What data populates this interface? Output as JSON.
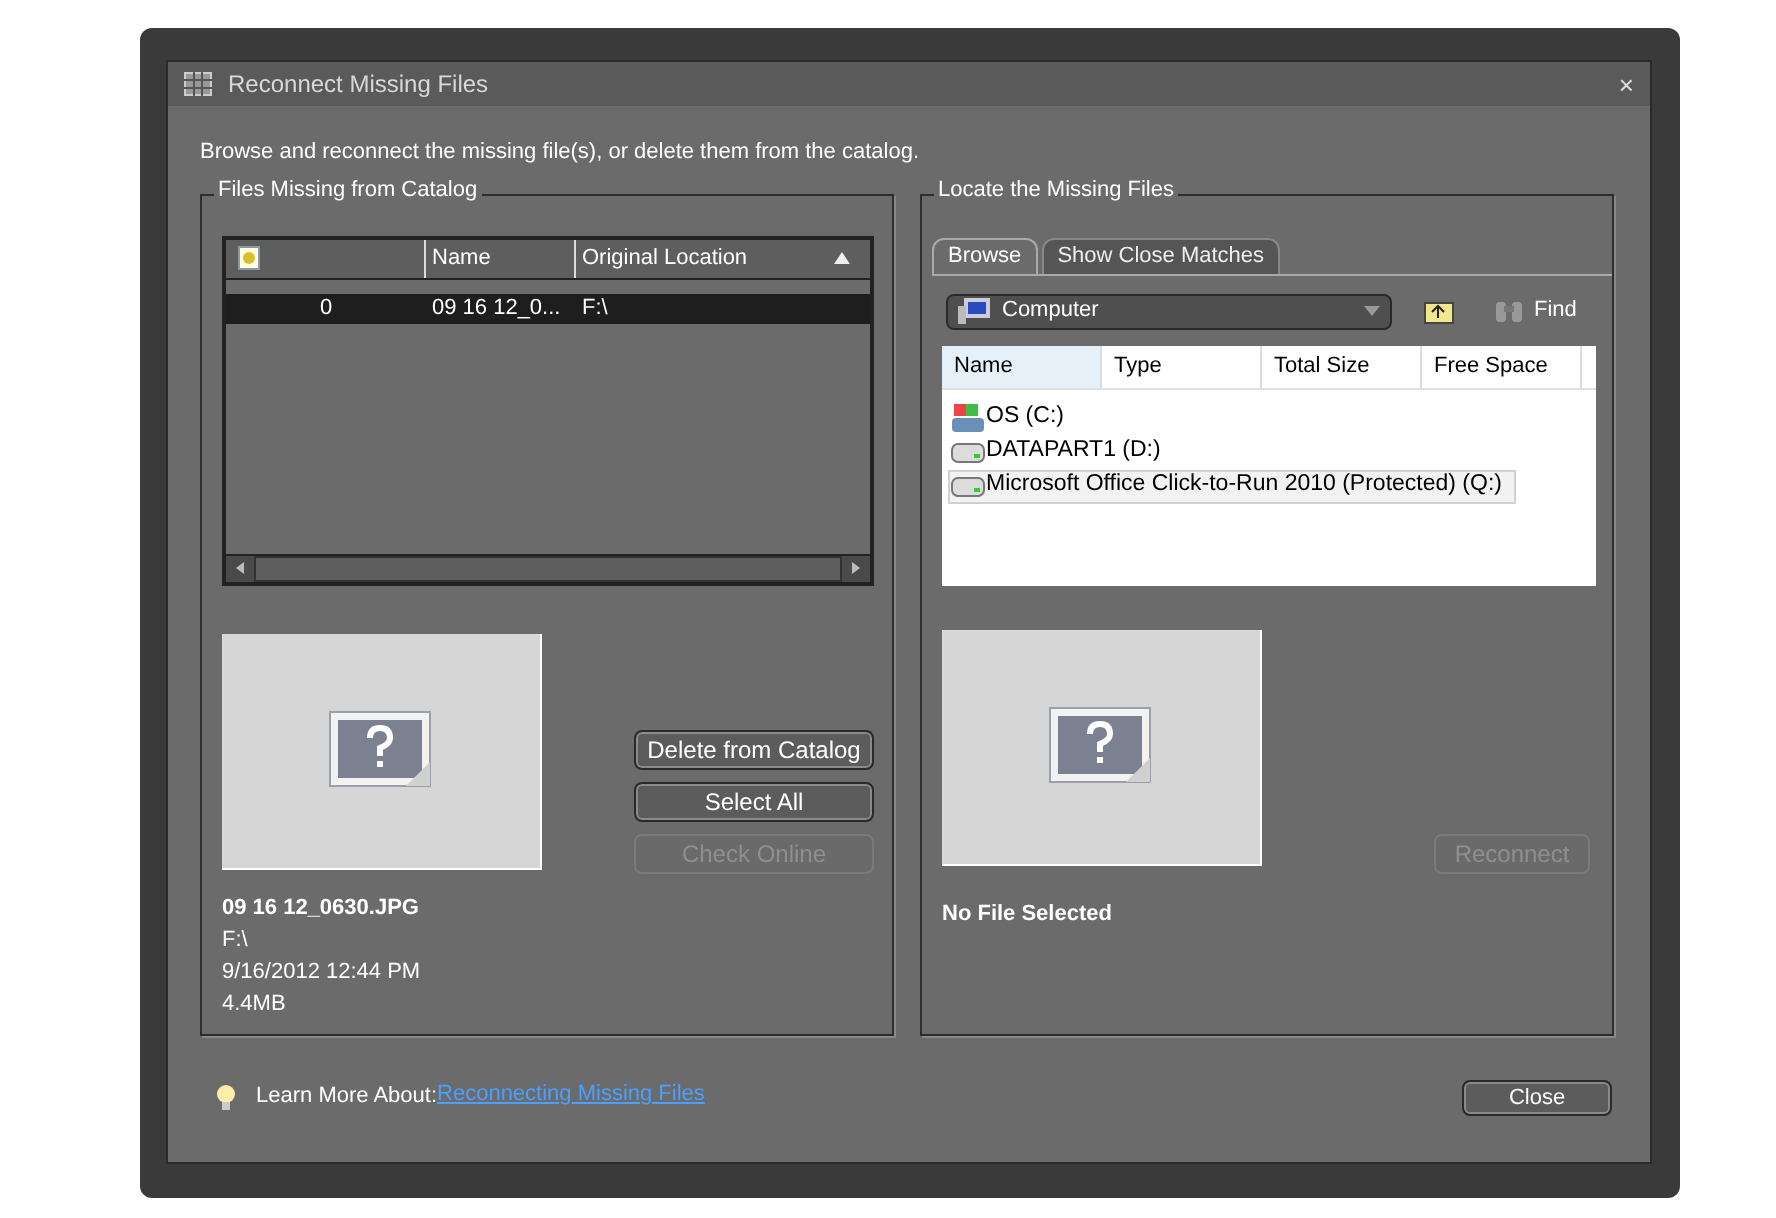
{
  "window": {
    "title": "Reconnect Missing Files",
    "close": "×"
  },
  "instructions": "Browse and reconnect the missing file(s), or delete them from the catalog.",
  "missing_panel": {
    "title": "Files Missing from Catalog",
    "table": {
      "columns": [
        "Name",
        "Original Location"
      ],
      "rows": [
        {
          "count": "0",
          "name": "09 16 12_0...",
          "location": "F:\\",
          "selected": true
        }
      ]
    },
    "file_info": {
      "name": "09 16 12_0630.JPG",
      "location": "F:\\",
      "date": "9/16/2012 12:44 PM",
      "size": "4.4MB"
    },
    "buttons": [
      {
        "label": "Delete from Catalog",
        "disabled": false
      },
      {
        "label": "Select All",
        "disabled": false
      },
      {
        "label": "Check Online",
        "disabled": true
      }
    ]
  },
  "locate_panel": {
    "title": "Locate the Missing Files",
    "tabs": [
      {
        "label": "Browse",
        "selected": true
      },
      {
        "label": "Show Close Matches",
        "selected": false
      }
    ],
    "location": "Computer",
    "find": "Find",
    "columns": [
      "Name",
      "Type",
      "Total Size",
      "Free Space"
    ],
    "drives": [
      {
        "label": "OS (C:)",
        "kind": "system",
        "selected": false
      },
      {
        "label": "DATAPART1 (D:)",
        "kind": "disk",
        "selected": false
      },
      {
        "label": "Microsoft Office Click-to-Run 2010 (Protected) (Q:)",
        "kind": "disk",
        "selected": true
      }
    ],
    "preview_caption": "No File Selected",
    "reconnect": {
      "label": "Reconnect",
      "disabled": true
    }
  },
  "footer": {
    "learn_more": "Learn More About:",
    "link": "Reconnecting Missing Files",
    "close": "Close"
  }
}
